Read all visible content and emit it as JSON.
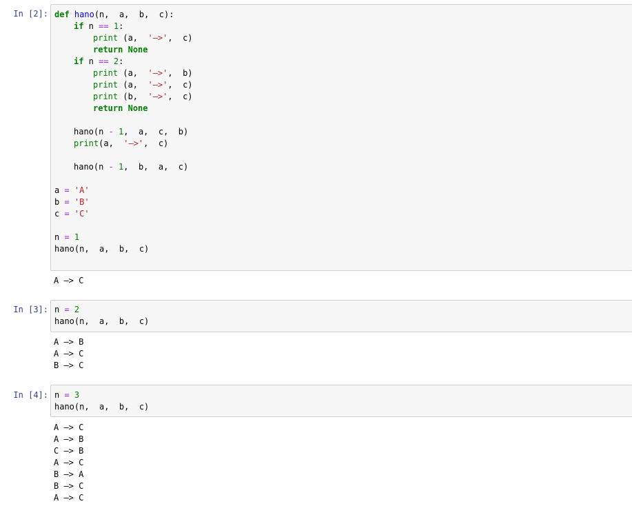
{
  "cells": [
    {
      "prompt": "In [2]:",
      "code_lines": [
        {
          "indent": 0,
          "segments": [
            {
              "t": "def",
              "c": "kw"
            },
            {
              "t": " "
            },
            {
              "t": "hano",
              "c": "fn"
            },
            {
              "t": "(n,  a,  b,  c):"
            }
          ]
        },
        {
          "indent": 1,
          "segments": [
            {
              "t": "if",
              "c": "kw"
            },
            {
              "t": " n "
            },
            {
              "t": "==",
              "c": "op"
            },
            {
              "t": " "
            },
            {
              "t": "1",
              "c": "num"
            },
            {
              "t": ":"
            }
          ]
        },
        {
          "indent": 2,
          "segments": [
            {
              "t": "print",
              "c": "bi"
            },
            {
              "t": " (a,  "
            },
            {
              "t": "'—>'",
              "c": "str"
            },
            {
              "t": ",  c)"
            }
          ]
        },
        {
          "indent": 2,
          "segments": [
            {
              "t": "return",
              "c": "kw"
            },
            {
              "t": " "
            },
            {
              "t": "None",
              "c": "kw"
            }
          ]
        },
        {
          "indent": 1,
          "segments": [
            {
              "t": "if",
              "c": "kw"
            },
            {
              "t": " n "
            },
            {
              "t": "==",
              "c": "op"
            },
            {
              "t": " "
            },
            {
              "t": "2",
              "c": "num"
            },
            {
              "t": ":"
            }
          ]
        },
        {
          "indent": 2,
          "segments": [
            {
              "t": "print",
              "c": "bi"
            },
            {
              "t": " (a,  "
            },
            {
              "t": "'—>'",
              "c": "str"
            },
            {
              "t": ",  b)"
            }
          ]
        },
        {
          "indent": 2,
          "segments": [
            {
              "t": "print",
              "c": "bi"
            },
            {
              "t": " (a,  "
            },
            {
              "t": "'—>'",
              "c": "str"
            },
            {
              "t": ",  c)"
            }
          ]
        },
        {
          "indent": 2,
          "segments": [
            {
              "t": "print",
              "c": "bi"
            },
            {
              "t": " (b,  "
            },
            {
              "t": "'—>'",
              "c": "str"
            },
            {
              "t": ",  c)"
            }
          ]
        },
        {
          "indent": 2,
          "segments": [
            {
              "t": "return",
              "c": "kw"
            },
            {
              "t": " "
            },
            {
              "t": "None",
              "c": "kw"
            }
          ]
        },
        {
          "indent": 0,
          "segments": []
        },
        {
          "indent": 1,
          "segments": [
            {
              "t": "hano(n "
            },
            {
              "t": "-",
              "c": "op"
            },
            {
              "t": " "
            },
            {
              "t": "1",
              "c": "num"
            },
            {
              "t": ",  a,  c,  b)"
            }
          ]
        },
        {
          "indent": 1,
          "segments": [
            {
              "t": "print",
              "c": "bi"
            },
            {
              "t": "(a,  "
            },
            {
              "t": "'—>'",
              "c": "str"
            },
            {
              "t": ",  c)"
            }
          ]
        },
        {
          "indent": 0,
          "segments": []
        },
        {
          "indent": 1,
          "segments": [
            {
              "t": "hano(n "
            },
            {
              "t": "-",
              "c": "op"
            },
            {
              "t": " "
            },
            {
              "t": "1",
              "c": "num"
            },
            {
              "t": ",  b,  a,  c)"
            }
          ]
        },
        {
          "indent": 0,
          "segments": []
        },
        {
          "indent": 0,
          "segments": [
            {
              "t": "a "
            },
            {
              "t": "=",
              "c": "op"
            },
            {
              "t": " "
            },
            {
              "t": "'A'",
              "c": "str"
            }
          ]
        },
        {
          "indent": 0,
          "segments": [
            {
              "t": "b "
            },
            {
              "t": "=",
              "c": "op"
            },
            {
              "t": " "
            },
            {
              "t": "'B'",
              "c": "str"
            }
          ]
        },
        {
          "indent": 0,
          "segments": [
            {
              "t": "c "
            },
            {
              "t": "=",
              "c": "op"
            },
            {
              "t": " "
            },
            {
              "t": "'C'",
              "c": "str"
            }
          ]
        },
        {
          "indent": 0,
          "segments": []
        },
        {
          "indent": 0,
          "segments": [
            {
              "t": "n "
            },
            {
              "t": "=",
              "c": "op"
            },
            {
              "t": " "
            },
            {
              "t": "1",
              "c": "num"
            }
          ]
        },
        {
          "indent": 0,
          "segments": [
            {
              "t": "hano(n,  a,  b,  c)"
            }
          ]
        }
      ],
      "output_lines": [
        "A —> C"
      ]
    },
    {
      "prompt": "In [3]:",
      "code_lines": [
        {
          "indent": 0,
          "segments": [
            {
              "t": "n "
            },
            {
              "t": "=",
              "c": "op"
            },
            {
              "t": " "
            },
            {
              "t": "2",
              "c": "num"
            }
          ]
        },
        {
          "indent": 0,
          "segments": [
            {
              "t": "hano(n,  a,  b,  c)"
            }
          ]
        }
      ],
      "output_lines": [
        "A —> B",
        "A —> C",
        "B —> C"
      ]
    },
    {
      "prompt": "In [4]:",
      "code_lines": [
        {
          "indent": 0,
          "segments": [
            {
              "t": "n "
            },
            {
              "t": "=",
              "c": "op"
            },
            {
              "t": " "
            },
            {
              "t": "3",
              "c": "num"
            }
          ]
        },
        {
          "indent": 0,
          "segments": [
            {
              "t": "hano(n,  a,  b,  c)"
            }
          ]
        }
      ],
      "output_lines": [
        "A —> C",
        "A —> B",
        "C —> B",
        "A —> C",
        "B —> A",
        "B —> C",
        "A —> C"
      ]
    }
  ]
}
